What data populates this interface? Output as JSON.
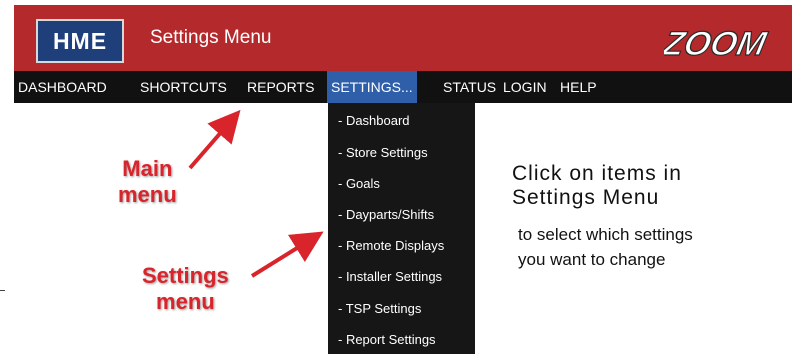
{
  "header": {
    "logo": "HME",
    "title": "Settings Menu",
    "brand_logo": "ZOOM"
  },
  "nav": {
    "items": [
      "DASHBOARD",
      "SHORTCUTS",
      "REPORTS",
      "SETTINGS...",
      "STATUS",
      "LOGIN",
      "HELP"
    ],
    "active": "SETTINGS..."
  },
  "dropdown": {
    "items": [
      "- Dashboard",
      "- Store Settings",
      "- Goals",
      "- Dayparts/Shifts",
      "- Remote Displays",
      "- Installer Settings",
      "- TSP Settings",
      "- Report Settings"
    ]
  },
  "annotations": {
    "main_menu_line1": "Main",
    "main_menu_line2": "menu",
    "settings_menu_line1": "Settings",
    "settings_menu_line2": "menu",
    "instruction_line1": "Click on items in",
    "instruction_line2": "Settings Menu",
    "instruction_line3": "to select which settings",
    "instruction_line4": "you want to change"
  },
  "colors": {
    "header_red": "#b42a2c",
    "nav_black": "#111111",
    "active_blue": "#2f5fa8",
    "callout_red": "#d8242a",
    "logo_navy": "#1f3f7a"
  }
}
